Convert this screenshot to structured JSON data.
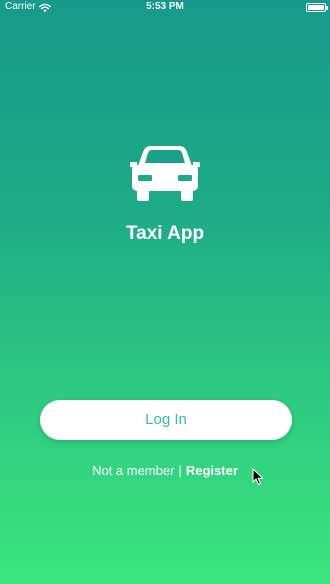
{
  "status_bar": {
    "carrier": "Carrier",
    "time": "5:53 PM",
    "wifi_icon": "wifi-icon",
    "battery_icon": "battery-icon",
    "battery_level": 1.0
  },
  "app": {
    "logo_icon": "car-icon",
    "title": "Taxi App"
  },
  "login": {
    "button_label": "Log In"
  },
  "register_prompt": {
    "text": "Not a member",
    "separator": "|",
    "link_label": "Register"
  },
  "colors": {
    "gradient_top": "#179A8B",
    "gradient_bottom": "#3BE57E",
    "button_background": "#FFFFFF",
    "button_text": "#3CB8A7",
    "foreground": "#FFFFFF"
  }
}
